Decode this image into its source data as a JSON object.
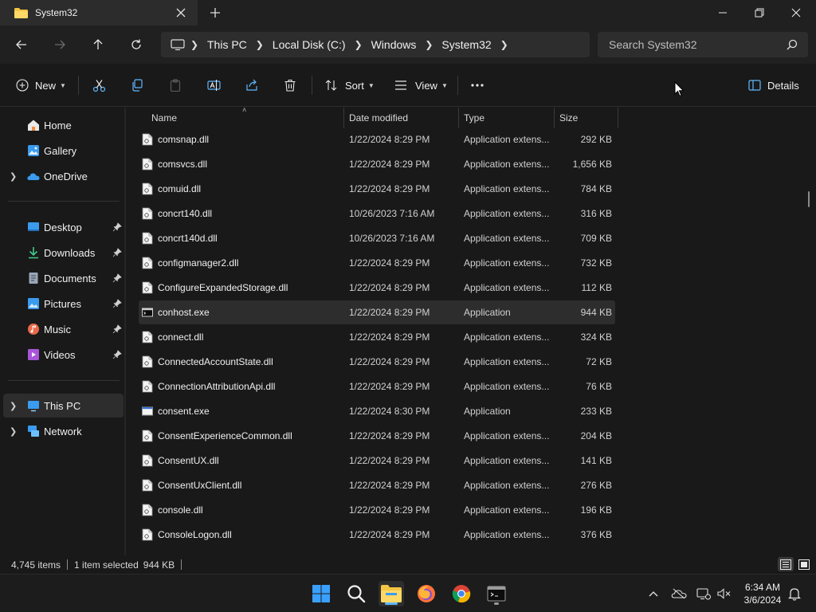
{
  "window": {
    "tab_title": "System32"
  },
  "address": {
    "crumbs": [
      "This PC",
      "Local Disk (C:)",
      "Windows",
      "System32"
    ],
    "search_placeholder": "Search System32"
  },
  "toolbar": {
    "new_label": "New",
    "sort_label": "Sort",
    "view_label": "View",
    "details_label": "Details"
  },
  "sidebar": {
    "items": [
      {
        "label": "Home",
        "icon": "home-icon"
      },
      {
        "label": "Gallery",
        "icon": "gallery-icon"
      },
      {
        "label": "OneDrive",
        "icon": "onedrive-icon"
      },
      {
        "label": "Desktop",
        "icon": "desktop-icon"
      },
      {
        "label": "Downloads",
        "icon": "downloads-icon"
      },
      {
        "label": "Documents",
        "icon": "documents-icon"
      },
      {
        "label": "Pictures",
        "icon": "pictures-icon"
      },
      {
        "label": "Music",
        "icon": "music-icon"
      },
      {
        "label": "Videos",
        "icon": "videos-icon"
      },
      {
        "label": "This PC",
        "icon": "this-pc-icon"
      },
      {
        "label": "Network",
        "icon": "network-icon"
      }
    ]
  },
  "columns": {
    "name": "Name",
    "date": "Date modified",
    "type": "Type",
    "size": "Size"
  },
  "files": [
    {
      "name": "comsnap.dll",
      "date": "1/22/2024 8:29 PM",
      "type": "Application extens...",
      "size": "292 KB",
      "kind": "dll"
    },
    {
      "name": "comsvcs.dll",
      "date": "1/22/2024 8:29 PM",
      "type": "Application extens...",
      "size": "1,656 KB",
      "kind": "dll"
    },
    {
      "name": "comuid.dll",
      "date": "1/22/2024 8:29 PM",
      "type": "Application extens...",
      "size": "784 KB",
      "kind": "dll"
    },
    {
      "name": "concrt140.dll",
      "date": "10/26/2023 7:16 AM",
      "type": "Application extens...",
      "size": "316 KB",
      "kind": "dll"
    },
    {
      "name": "concrt140d.dll",
      "date": "10/26/2023 7:16 AM",
      "type": "Application extens...",
      "size": "709 KB",
      "kind": "dll"
    },
    {
      "name": "configmanager2.dll",
      "date": "1/22/2024 8:29 PM",
      "type": "Application extens...",
      "size": "732 KB",
      "kind": "dll"
    },
    {
      "name": "ConfigureExpandedStorage.dll",
      "date": "1/22/2024 8:29 PM",
      "type": "Application extens...",
      "size": "112 KB",
      "kind": "dll"
    },
    {
      "name": "conhost.exe",
      "date": "1/22/2024 8:29 PM",
      "type": "Application",
      "size": "944 KB",
      "kind": "console",
      "selected": true
    },
    {
      "name": "connect.dll",
      "date": "1/22/2024 8:29 PM",
      "type": "Application extens...",
      "size": "324 KB",
      "kind": "dll"
    },
    {
      "name": "ConnectedAccountState.dll",
      "date": "1/22/2024 8:29 PM",
      "type": "Application extens...",
      "size": "72 KB",
      "kind": "dll"
    },
    {
      "name": "ConnectionAttributionApi.dll",
      "date": "1/22/2024 8:29 PM",
      "type": "Application extens...",
      "size": "76 KB",
      "kind": "dll"
    },
    {
      "name": "consent.exe",
      "date": "1/22/2024 8:30 PM",
      "type": "Application",
      "size": "233 KB",
      "kind": "window"
    },
    {
      "name": "ConsentExperienceCommon.dll",
      "date": "1/22/2024 8:29 PM",
      "type": "Application extens...",
      "size": "204 KB",
      "kind": "dll"
    },
    {
      "name": "ConsentUX.dll",
      "date": "1/22/2024 8:29 PM",
      "type": "Application extens...",
      "size": "141 KB",
      "kind": "dll"
    },
    {
      "name": "ConsentUxClient.dll",
      "date": "1/22/2024 8:29 PM",
      "type": "Application extens...",
      "size": "276 KB",
      "kind": "dll"
    },
    {
      "name": "console.dll",
      "date": "1/22/2024 8:29 PM",
      "type": "Application extens...",
      "size": "196 KB",
      "kind": "dll"
    },
    {
      "name": "ConsoleLogon.dll",
      "date": "1/22/2024 8:29 PM",
      "type": "Application extens...",
      "size": "376 KB",
      "kind": "dll"
    }
  ],
  "status": {
    "item_count": "4,745 items",
    "selected": "1 item selected",
    "selected_size": "944 KB"
  },
  "clock": {
    "time": "6:34 AM",
    "date": "3/6/2024"
  },
  "colors": {
    "accent": "#4cc2ff",
    "folder": "#f4c542",
    "selected_row": "#2d2d2d"
  }
}
